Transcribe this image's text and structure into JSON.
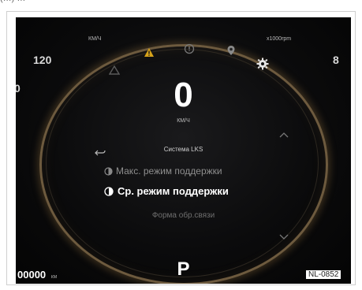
{
  "top_cut_text": "(…) …",
  "cluster": {
    "speed_unit_top": "КМ/Ч",
    "rpm_unit_top": "x1000rpm",
    "speed_scale_120": "120",
    "rpm_scale_8": "8",
    "left_cut_digit": "0",
    "speed_value": "0",
    "speed_unit": "КМ/Ч",
    "odometer_value": "00000",
    "odometer_unit": "км",
    "gear": "P"
  },
  "menu": {
    "title": "Система LKS",
    "items": [
      {
        "label": "Макс. режим поддержки",
        "selected": false
      },
      {
        "label": "Ср. режим поддержки",
        "selected": true
      },
      {
        "label": "Форма обр.связи",
        "selected": false
      }
    ]
  },
  "image_code": "NL-0852",
  "colors": {
    "warning_amber": "#d6a21a",
    "rim_gold": "#6d5a3e",
    "text_white": "#ffffff",
    "text_dim": "#8a8a8a"
  }
}
